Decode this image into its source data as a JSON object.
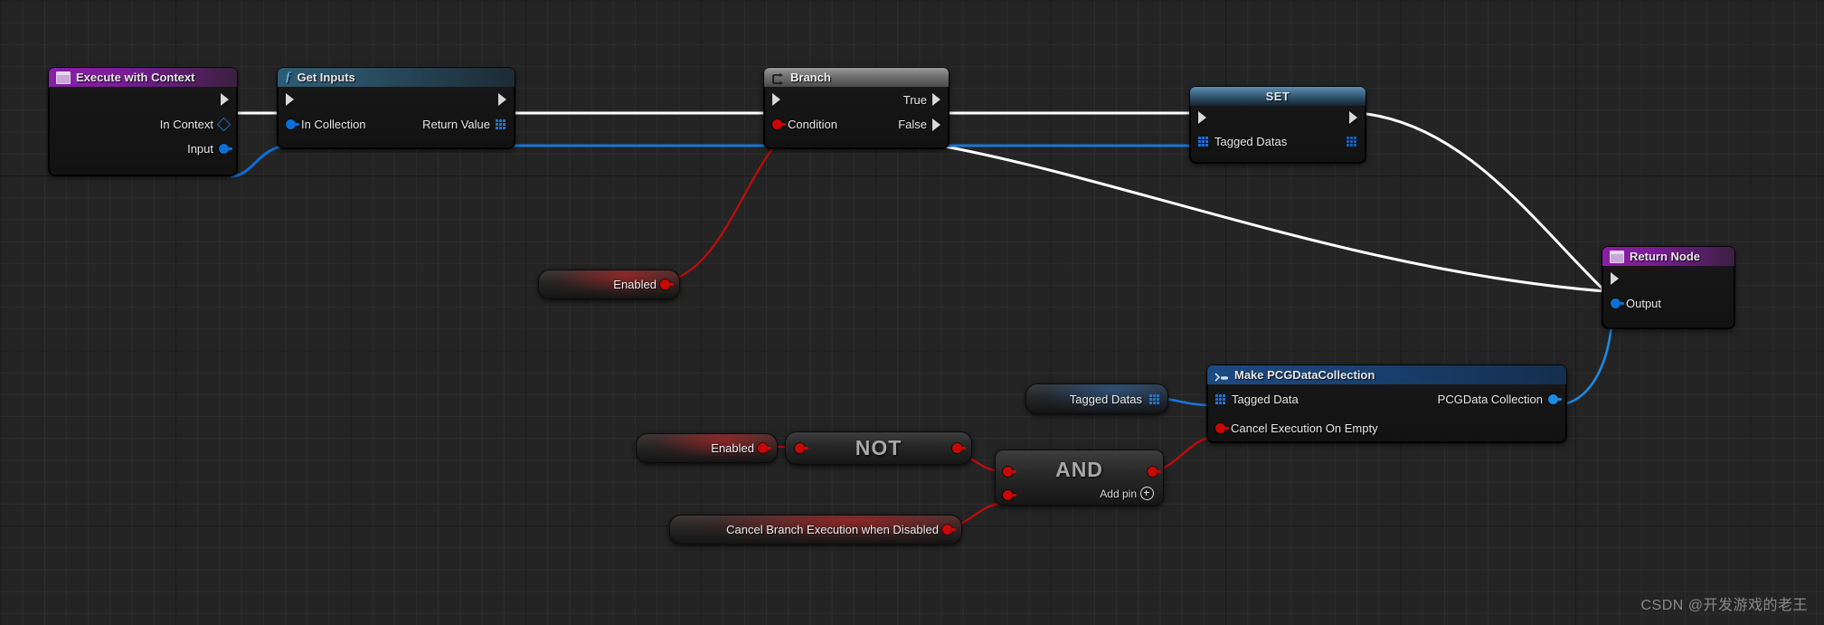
{
  "graph": {
    "title": "Unreal Engine Blueprint Graph",
    "background_color": "#242424",
    "grid_minor_color": "#2e2e2e",
    "grid_major_color": "#121212",
    "watermark": "CSDN @开发游戏的老王"
  },
  "colors": {
    "exec_wire": "#ffffff",
    "bool_wire": "#c30a0a",
    "object_wire": "#0b6fd6",
    "struct_wire": "#1a8ce8",
    "header_purple": "#8a1fa8",
    "header_teal": "#2c5c74",
    "header_gray": "#8b8b8b",
    "header_set_blue": "#2c4d66",
    "header_make_blue": "#1c4a82"
  },
  "nodes": {
    "execute_with_context": {
      "title": "Execute with Context",
      "icon": "event-node-icon",
      "header_style": "purple",
      "outputs": [
        {
          "label": "",
          "pin": "exec-pin"
        },
        {
          "label": "In Context",
          "pin": "diamond-pin"
        },
        {
          "label": "Input",
          "pin": "object-pin"
        }
      ]
    },
    "get_inputs": {
      "title": "Get Inputs",
      "icon": "function-f-icon",
      "header_style": "teal",
      "inputs": [
        {
          "label": "",
          "pin": "exec-pin"
        },
        {
          "label": "In Collection",
          "pin": "object-pin"
        }
      ],
      "outputs": [
        {
          "label": "",
          "pin": "exec-pin"
        },
        {
          "label": "Return Value",
          "pin": "array-pin"
        }
      ]
    },
    "branch": {
      "title": "Branch",
      "icon": "branch-icon",
      "header_style": "gray",
      "inputs": [
        {
          "label": "",
          "pin": "exec-pin"
        },
        {
          "label": "Condition",
          "pin": "bool-pin"
        }
      ],
      "outputs": [
        {
          "label": "True",
          "pin": "exec-pin"
        },
        {
          "label": "False",
          "pin": "exec-pin"
        }
      ]
    },
    "set_tagged_datas": {
      "title": "SET",
      "header_style": "set-blue",
      "inputs": [
        {
          "label": "",
          "pin": "exec-pin"
        },
        {
          "label": "Tagged Datas",
          "pin": "array-pin"
        }
      ],
      "outputs": [
        {
          "label": "",
          "pin": "exec-pin"
        },
        {
          "label": "",
          "pin": "array-pin"
        }
      ]
    },
    "return_node": {
      "title": "Return Node",
      "icon": "return-node-icon",
      "header_style": "purple",
      "inputs": [
        {
          "label": "",
          "pin": "exec-pin"
        },
        {
          "label": "Output",
          "pin": "object-pin"
        }
      ]
    },
    "make_pcg_data_collection": {
      "title": "Make PCGDataCollection",
      "icon": "make-struct-icon",
      "header_style": "make-blue",
      "inputs": [
        {
          "label": "Tagged Data",
          "pin": "array-pin"
        },
        {
          "label": "Cancel Execution On Empty",
          "pin": "bool-pin"
        }
      ],
      "outputs": [
        {
          "label": "PCGData Collection",
          "pin": "struct-pin"
        }
      ]
    },
    "enabled_top": {
      "label": "Enabled",
      "pin": "bool-pin",
      "style": "red"
    },
    "enabled_bottom": {
      "label": "Enabled",
      "pin": "bool-pin",
      "style": "red"
    },
    "not_gate": {
      "label": "NOT",
      "style": "plain"
    },
    "and_gate": {
      "label": "AND",
      "add_pin_label": "Add pin",
      "style": "plain"
    },
    "cancel_branch": {
      "label": "Cancel Branch Execution when Disabled",
      "pin": "bool-pin",
      "style": "red"
    },
    "tagged_datas_getter": {
      "label": "Tagged Datas",
      "pin": "array-pin",
      "style": "blue"
    }
  }
}
